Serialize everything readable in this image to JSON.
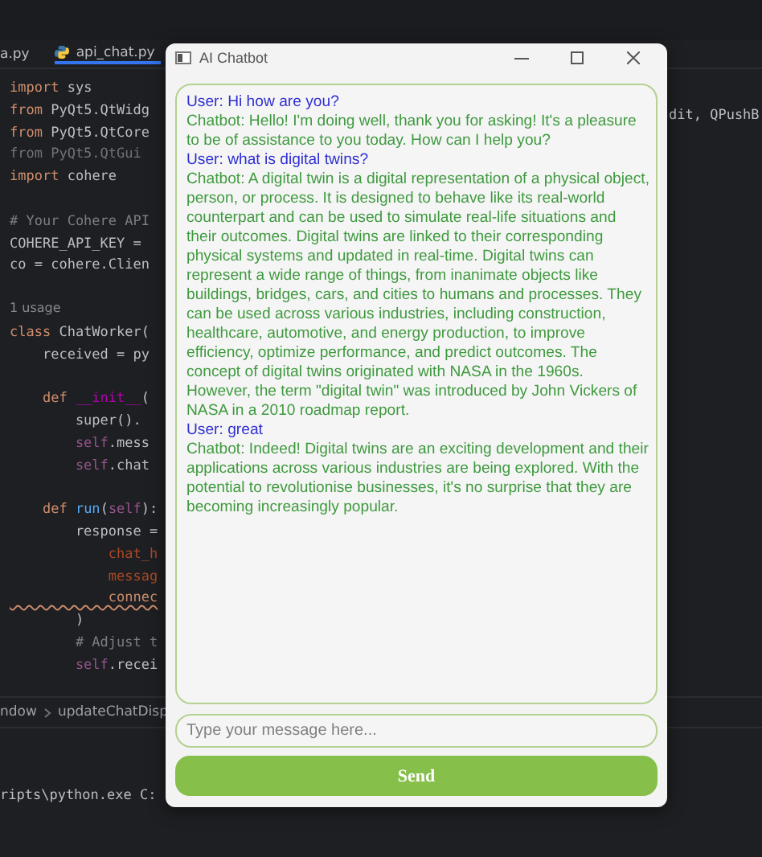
{
  "editor": {
    "tabs": [
      {
        "label": "a.py",
        "selected": false
      },
      {
        "label": "api_chat.py",
        "selected": true
      }
    ],
    "code_lines": [
      {
        "kind": "code",
        "tokens": [
          {
            "kind": "keyword",
            "text": "import"
          },
          {
            "kind": "plain",
            "text": " sys"
          }
        ]
      },
      {
        "kind": "code",
        "tokens": [
          {
            "kind": "keyword",
            "text": "from"
          },
          {
            "kind": "plain",
            "text": " PyQt5.QtWidg"
          }
        ]
      },
      {
        "kind": "code",
        "tokens": [
          {
            "kind": "keyword",
            "text": "from"
          },
          {
            "kind": "plain",
            "text": " PyQt5.QtCore"
          }
        ]
      },
      {
        "kind": "code",
        "tokens": [
          {
            "kind": "unused",
            "text": "from PyQt5.QtGui"
          }
        ]
      },
      {
        "kind": "code",
        "tokens": [
          {
            "kind": "keyword",
            "text": "import"
          },
          {
            "kind": "plain",
            "text": " cohere"
          }
        ]
      },
      {
        "kind": "blank"
      },
      {
        "kind": "code",
        "tokens": [
          {
            "kind": "comment",
            "text": "# Your Cohere API"
          }
        ]
      },
      {
        "kind": "code",
        "tokens": [
          {
            "kind": "plain",
            "text": "COHERE_API_KEY ="
          }
        ]
      },
      {
        "kind": "code",
        "tokens": [
          {
            "kind": "plain",
            "text": "co = cohere.Clien"
          }
        ]
      },
      {
        "kind": "blank"
      },
      {
        "kind": "code",
        "tokens": [
          {
            "kind": "hint",
            "text": "1 usage"
          }
        ]
      },
      {
        "kind": "code",
        "tokens": [
          {
            "kind": "keyword",
            "text": "class"
          },
          {
            "kind": "plain",
            "text": " ChatWorker("
          }
        ]
      },
      {
        "kind": "code",
        "tokens": [
          {
            "kind": "plain",
            "text": "    received = py"
          }
        ]
      },
      {
        "kind": "blank"
      },
      {
        "kind": "code",
        "tokens": [
          {
            "kind": "keyword",
            "text": "    def"
          },
          {
            "kind": "dunder",
            "text": " __init__"
          },
          {
            "kind": "plain",
            "text": "("
          }
        ]
      },
      {
        "kind": "code",
        "tokens": [
          {
            "kind": "plain",
            "text": "        super()."
          }
        ]
      },
      {
        "kind": "code",
        "tokens": [
          {
            "kind": "self",
            "text": "        self"
          },
          {
            "kind": "plain",
            "text": ".mess"
          }
        ]
      },
      {
        "kind": "code",
        "tokens": [
          {
            "kind": "self",
            "text": "        self"
          },
          {
            "kind": "plain",
            "text": ".chat"
          }
        ]
      },
      {
        "kind": "blank"
      },
      {
        "kind": "code",
        "tokens": [
          {
            "kind": "keyword",
            "text": "    def"
          },
          {
            "kind": "func",
            "text": " run"
          },
          {
            "kind": "plain",
            "text": "("
          },
          {
            "kind": "self",
            "text": "self"
          },
          {
            "kind": "plain",
            "text": "):"
          }
        ]
      },
      {
        "kind": "code",
        "tokens": [
          {
            "kind": "plain",
            "text": "        response ="
          }
        ]
      },
      {
        "kind": "code",
        "tokens": [
          {
            "kind": "param",
            "text": "            chat_h"
          }
        ]
      },
      {
        "kind": "code",
        "tokens": [
          {
            "kind": "param",
            "text": "            messag"
          }
        ]
      },
      {
        "kind": "code",
        "tokens": [
          {
            "kind": "warn",
            "text": "            connec"
          }
        ]
      },
      {
        "kind": "code",
        "tokens": [
          {
            "kind": "plain",
            "text": "        )"
          }
        ]
      },
      {
        "kind": "code",
        "tokens": [
          {
            "kind": "comment",
            "text": "        # Adjust t"
          }
        ]
      },
      {
        "kind": "code",
        "tokens": [
          {
            "kind": "self",
            "text": "        self"
          },
          {
            "kind": "plain",
            "text": ".recei"
          }
        ]
      }
    ],
    "right_code": "dit, QPushB",
    "breadcrumb": [
      "ndow",
      "updateChatDisp"
    ],
    "terminal": "ripts\\python.exe C:"
  },
  "window": {
    "title": "AI Chatbot",
    "messages": [
      {
        "kind": "user",
        "text": "User: Hi how are you?"
      },
      {
        "kind": "bot",
        "text": "Chatbot: Hello! I'm doing well, thank you for asking! It's a pleasure to be of assistance to you today. How can I help you?"
      },
      {
        "kind": "user",
        "text": "User: what is digital twins?"
      },
      {
        "kind": "bot",
        "text": "Chatbot: A digital twin is a digital representation of a physical object, person, or process. It is designed to behave like its real-world counterpart and can be used to simulate real-life situations and their outcomes. Digital twins are linked to their corresponding physical systems and updated in real-time. Digital twins can represent a wide range of things, from inanimate objects like buildings, bridges, cars, and cities to humans and processes. They can be used across various industries, including construction, healthcare, automotive, and energy production, to improve efficiency, optimize performance, and predict outcomes. The concept of digital twins originated with NASA in the 1960s. However, the term \"digital twin\" was introduced by John Vickers of NASA in a 2010 roadmap report."
      },
      {
        "kind": "user",
        "text": "User: great"
      },
      {
        "kind": "bot",
        "text": "Chatbot: Indeed! Digital twins are an exciting development and their applications across various industries are being explored. With the potential to revolutionise businesses, it's no surprise that they are becoming increasingly popular."
      }
    ],
    "input": {
      "placeholder": "Type your message here..."
    },
    "send_button": "Send"
  }
}
